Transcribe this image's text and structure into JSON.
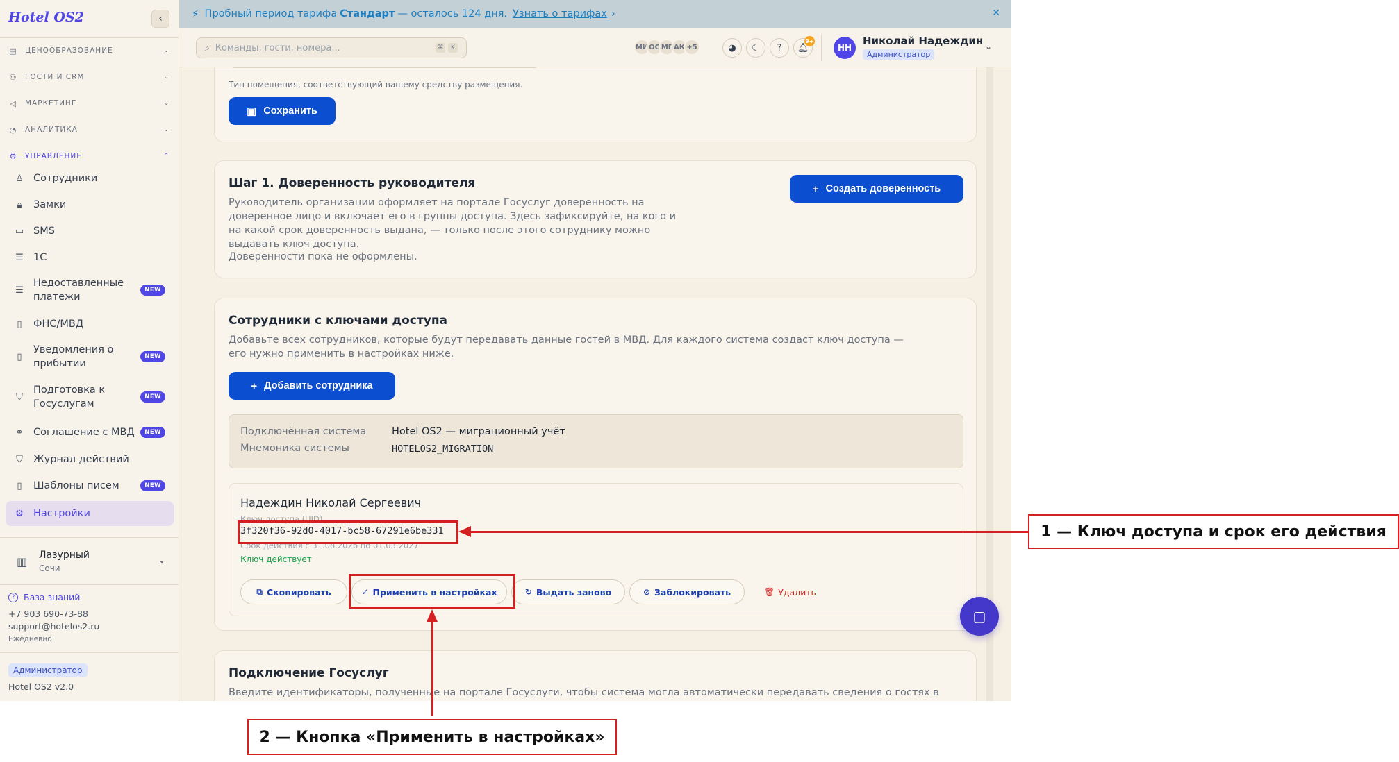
{
  "sidebar": {
    "logo": "Hotel OS2",
    "sections": [
      {
        "label": "ЦЕНООБРАЗОВАНИЕ",
        "icon": "price-tag-icon"
      },
      {
        "label": "ГОСТИ И CRM",
        "icon": "users-icon"
      },
      {
        "label": "МАРКЕТИНГ",
        "icon": "megaphone-icon"
      },
      {
        "label": "АНАЛИТИКА",
        "icon": "pie-chart-icon"
      },
      {
        "label": "УПРАВЛЕНИЕ",
        "icon": "gear-icon"
      }
    ],
    "items": [
      {
        "label": "Сотрудники",
        "icon": "user-icon"
      },
      {
        "label": "Замки",
        "icon": "lock-icon"
      },
      {
        "label": "SMS",
        "icon": "message-icon"
      },
      {
        "label": "1С",
        "icon": "database-icon"
      },
      {
        "label": "Недоставленные платежи",
        "icon": "database-icon",
        "badge": "NEW"
      },
      {
        "label": "ФНС/МВД",
        "icon": "document-icon"
      },
      {
        "label": "Уведомления о прибытии",
        "icon": "document-icon",
        "badge": "NEW"
      },
      {
        "label": "Подготовка к Госуслугам",
        "icon": "shield-check-icon",
        "badge": "NEW"
      },
      {
        "label": "Соглашение с МВД",
        "icon": "handshake-icon",
        "badge": "NEW"
      },
      {
        "label": "Журнал действий",
        "icon": "shield-icon"
      },
      {
        "label": "Шаблоны писем",
        "icon": "document-icon",
        "badge": "NEW"
      },
      {
        "label": "Настройки",
        "icon": "gear-icon"
      }
    ],
    "hotel": {
      "name": "Лазурный",
      "city": "Сочи"
    },
    "knowledge_base": "База знаний",
    "phone": "+7 903 690-73-88",
    "email": "support@hotelos2.ru",
    "schedule": "Ежедневно",
    "role": "Администратор",
    "version": "Hotel OS2 v2.0"
  },
  "banner": {
    "prefix": "Пробный период тарифа",
    "plan": "Стандарт",
    "suffix": "— осталось 124 дня.",
    "link": "Узнать о тарифах",
    "link_arrow": "›"
  },
  "header": {
    "search_placeholder": "Команды, гости, номера...",
    "kbd1": "⌘",
    "kbd2": "K",
    "avatars": [
      "МИ",
      "ОС",
      "МГ",
      "АК",
      "+5"
    ],
    "notif_count": "9+",
    "user_initials": "НН",
    "user_name": "Николай Надеждин",
    "user_role": "Администратор"
  },
  "main": {
    "top_hint": "Тип помещения, соответствующий вашему средству размещения.",
    "save_label": "Сохранить",
    "step1": {
      "title": "Шаг 1. Доверенность руководителя",
      "text": "Руководитель организации оформляет на портале Госуслуг доверенность на доверенное лицо и включает его в группы доступа. Здесь зафиксируйте, на кого и на какой срок доверенность выдана, — только после этого сотруднику можно выдавать ключ доступа.",
      "empty": "Доверенности пока не оформлены.",
      "create_label": "Создать доверенность"
    },
    "employees": {
      "title": "Сотрудники с ключами доступа",
      "text": "Добавьте всех сотрудников, которые будут передавать данные гостей в МВД. Для каждого система создаст ключ доступа — его нужно применить в настройках ниже.",
      "add_label": "Добавить сотрудника",
      "system_label": "Подключённая система",
      "system_value": "Hotel OS2 — миграционный учёт",
      "mnemonic_label": "Мнемоника системы",
      "mnemonic_value": "HOTELOS2_MIGRATION",
      "employee": {
        "name": "Надеждин Николай Сергеевич",
        "uid_label": "Ключ доступа (UID)",
        "uid": "3f320f36-92d0-4017-bc58-67291e6be331",
        "validity": "Срок действия с 31.08.2026 по 01.03.2027",
        "status": "Ключ действует",
        "copy_label": "Скопировать",
        "apply_label": "Применить в настройках",
        "reissue_label": "Выдать заново",
        "block_label": "Заблокировать",
        "delete_label": "Удалить"
      }
    },
    "gosuslugi": {
      "title": "Подключение Госуслуг",
      "text": "Введите идентификаторы, полученные на портале Госуслуги, чтобы система могла автоматически передавать сведения о гостях в МВД."
    }
  },
  "annotations": {
    "callout1": "1 — Ключ доступа и срок его действия",
    "callout2": "2 — Кнопка «Применить в настройках»"
  },
  "colors": {
    "accent": "#4f46e5",
    "primary_button": "#0b4ecf",
    "annotation": "#d42020",
    "success": "#16a34a",
    "danger": "#dc2626"
  }
}
